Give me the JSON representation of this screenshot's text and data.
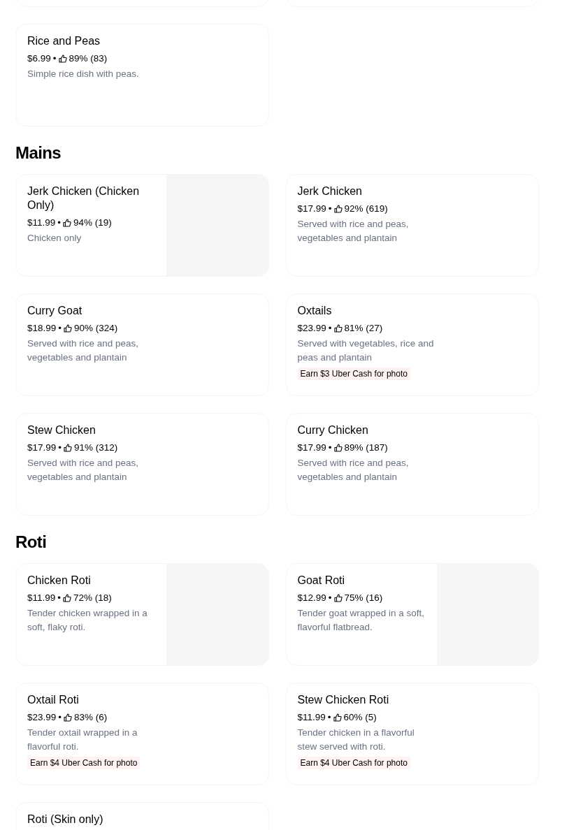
{
  "sections": [
    {
      "items": [
        {
          "title": "Rice and Peas",
          "price": "$6.99",
          "separator": "•",
          "rating": "89% (83)",
          "description": "Simple rice dish with peas.",
          "kind": "plain"
        }
      ]
    },
    {
      "heading": "Mains",
      "items": [
        {
          "title": "Jerk Chicken (Chicken Only)",
          "price": "$11.99",
          "separator": "•",
          "rating": "94% (19)",
          "description": "Chicken only",
          "kind": "photo"
        },
        {
          "title": "Jerk Chicken",
          "price": "$17.99",
          "separator": "•",
          "rating": "92% (619)",
          "description": "Served with rice and peas, vegetables and plantain",
          "kind": "plain"
        },
        {
          "title": "Curry Goat",
          "price": "$18.99",
          "separator": "•",
          "rating": "90% (324)",
          "description": "Served with rice and peas, vegetables and plantain",
          "kind": "plain"
        },
        {
          "title": "Oxtails",
          "price": "$23.99",
          "separator": "•",
          "rating": "81% (27)",
          "description": "Served with vegetables, rice and peas and plantain",
          "kind": "plain",
          "promo": "Earn $3 Uber Cash for photo"
        },
        {
          "title": "Stew Chicken",
          "price": "$17.99",
          "separator": "•",
          "rating": "91% (312)",
          "description": "Served with rice and peas, vegetables and plantain",
          "kind": "plain"
        },
        {
          "title": "Curry Chicken",
          "price": "$17.99",
          "separator": "•",
          "rating": "89% (187)",
          "description": "Served with rice and peas, vegetables and plantain",
          "kind": "plain"
        }
      ]
    },
    {
      "heading": "Roti",
      "items": [
        {
          "title": "Chicken Roti",
          "price": "$11.99",
          "separator": "•",
          "rating": "72% (18)",
          "description": "Tender chicken wrapped in a soft, flaky roti.",
          "kind": "photo"
        },
        {
          "title": "Goat Roti",
          "price": "$12.99",
          "separator": "•",
          "rating": "75% (16)",
          "description": "Tender goat wrapped in a soft, flavorful flatbread.",
          "kind": "photo"
        },
        {
          "title": "Oxtail Roti",
          "price": "$23.99",
          "separator": "•",
          "rating": "83% (6)",
          "description": "Tender oxtail wrapped in a flavorful roti.",
          "kind": "plain",
          "promo": "Earn $4 Uber Cash for photo"
        },
        {
          "title": "Stew Chicken Roti",
          "price": "$11.99",
          "separator": "•",
          "rating": "60% (5)",
          "description": "Tender chicken in a flavorful stew served with roti.",
          "kind": "plain",
          "promo": "Earn $4 Uber Cash for photo"
        },
        {
          "title": "Roti (Skin only)"
        }
      ]
    }
  ]
}
